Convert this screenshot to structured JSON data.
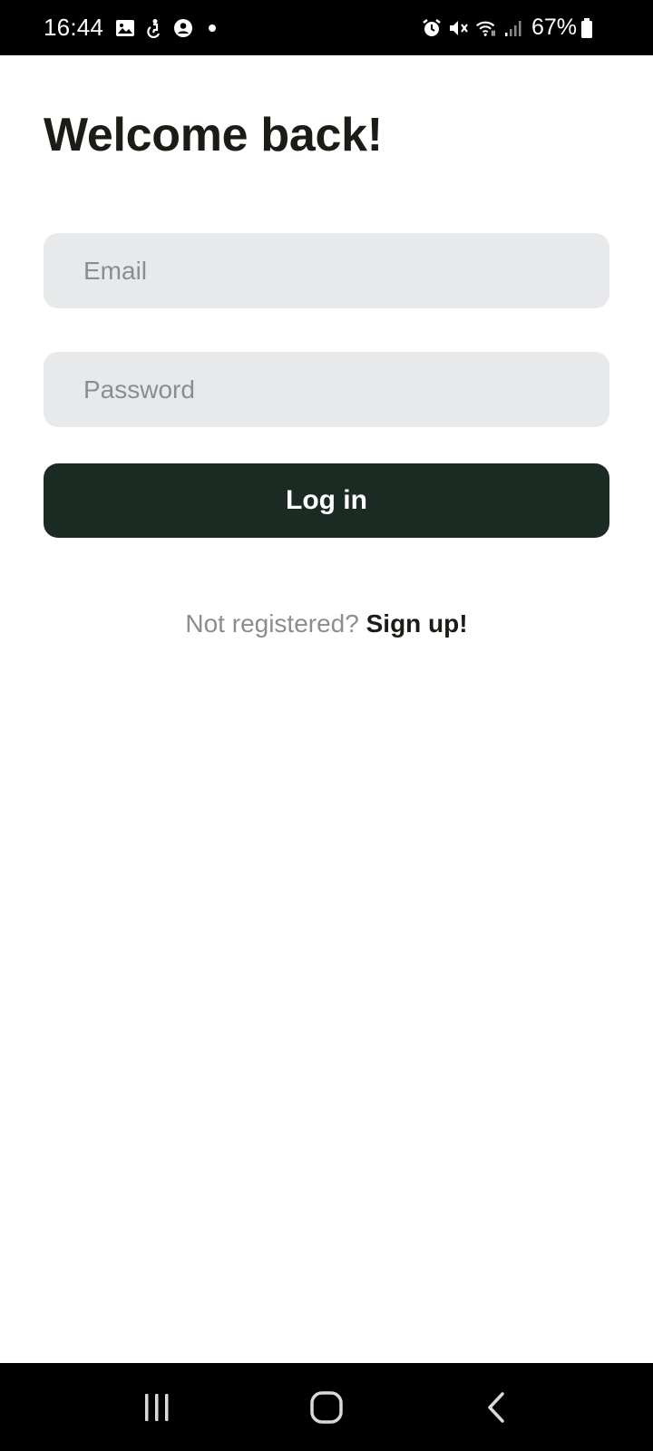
{
  "status_bar": {
    "time": "16:44",
    "battery_percent": "67%",
    "left_icons": [
      "image-icon",
      "accessibility-icon",
      "account-circle-icon",
      "dot-icon"
    ],
    "right_icons": [
      "alarm-icon",
      "mute-icon",
      "wifi-icon",
      "signal-icon",
      "battery-icon"
    ]
  },
  "login": {
    "title": "Welcome back!",
    "email_placeholder": "Email",
    "email_value": "",
    "password_placeholder": "Password",
    "password_value": "",
    "login_label": "Log in",
    "signup_prompt": "Not registered?",
    "signup_link": "Sign up!"
  },
  "nav_bar": {
    "buttons": [
      "recent-apps-icon",
      "home-icon",
      "back-icon"
    ]
  },
  "colors": {
    "title_text": "#1c1c16",
    "input_background": "#e8e9eb",
    "placeholder_text": "#8b8d90",
    "button_background": "#1b2a22",
    "button_text": "#ffffff",
    "system_bar": "#000000"
  }
}
